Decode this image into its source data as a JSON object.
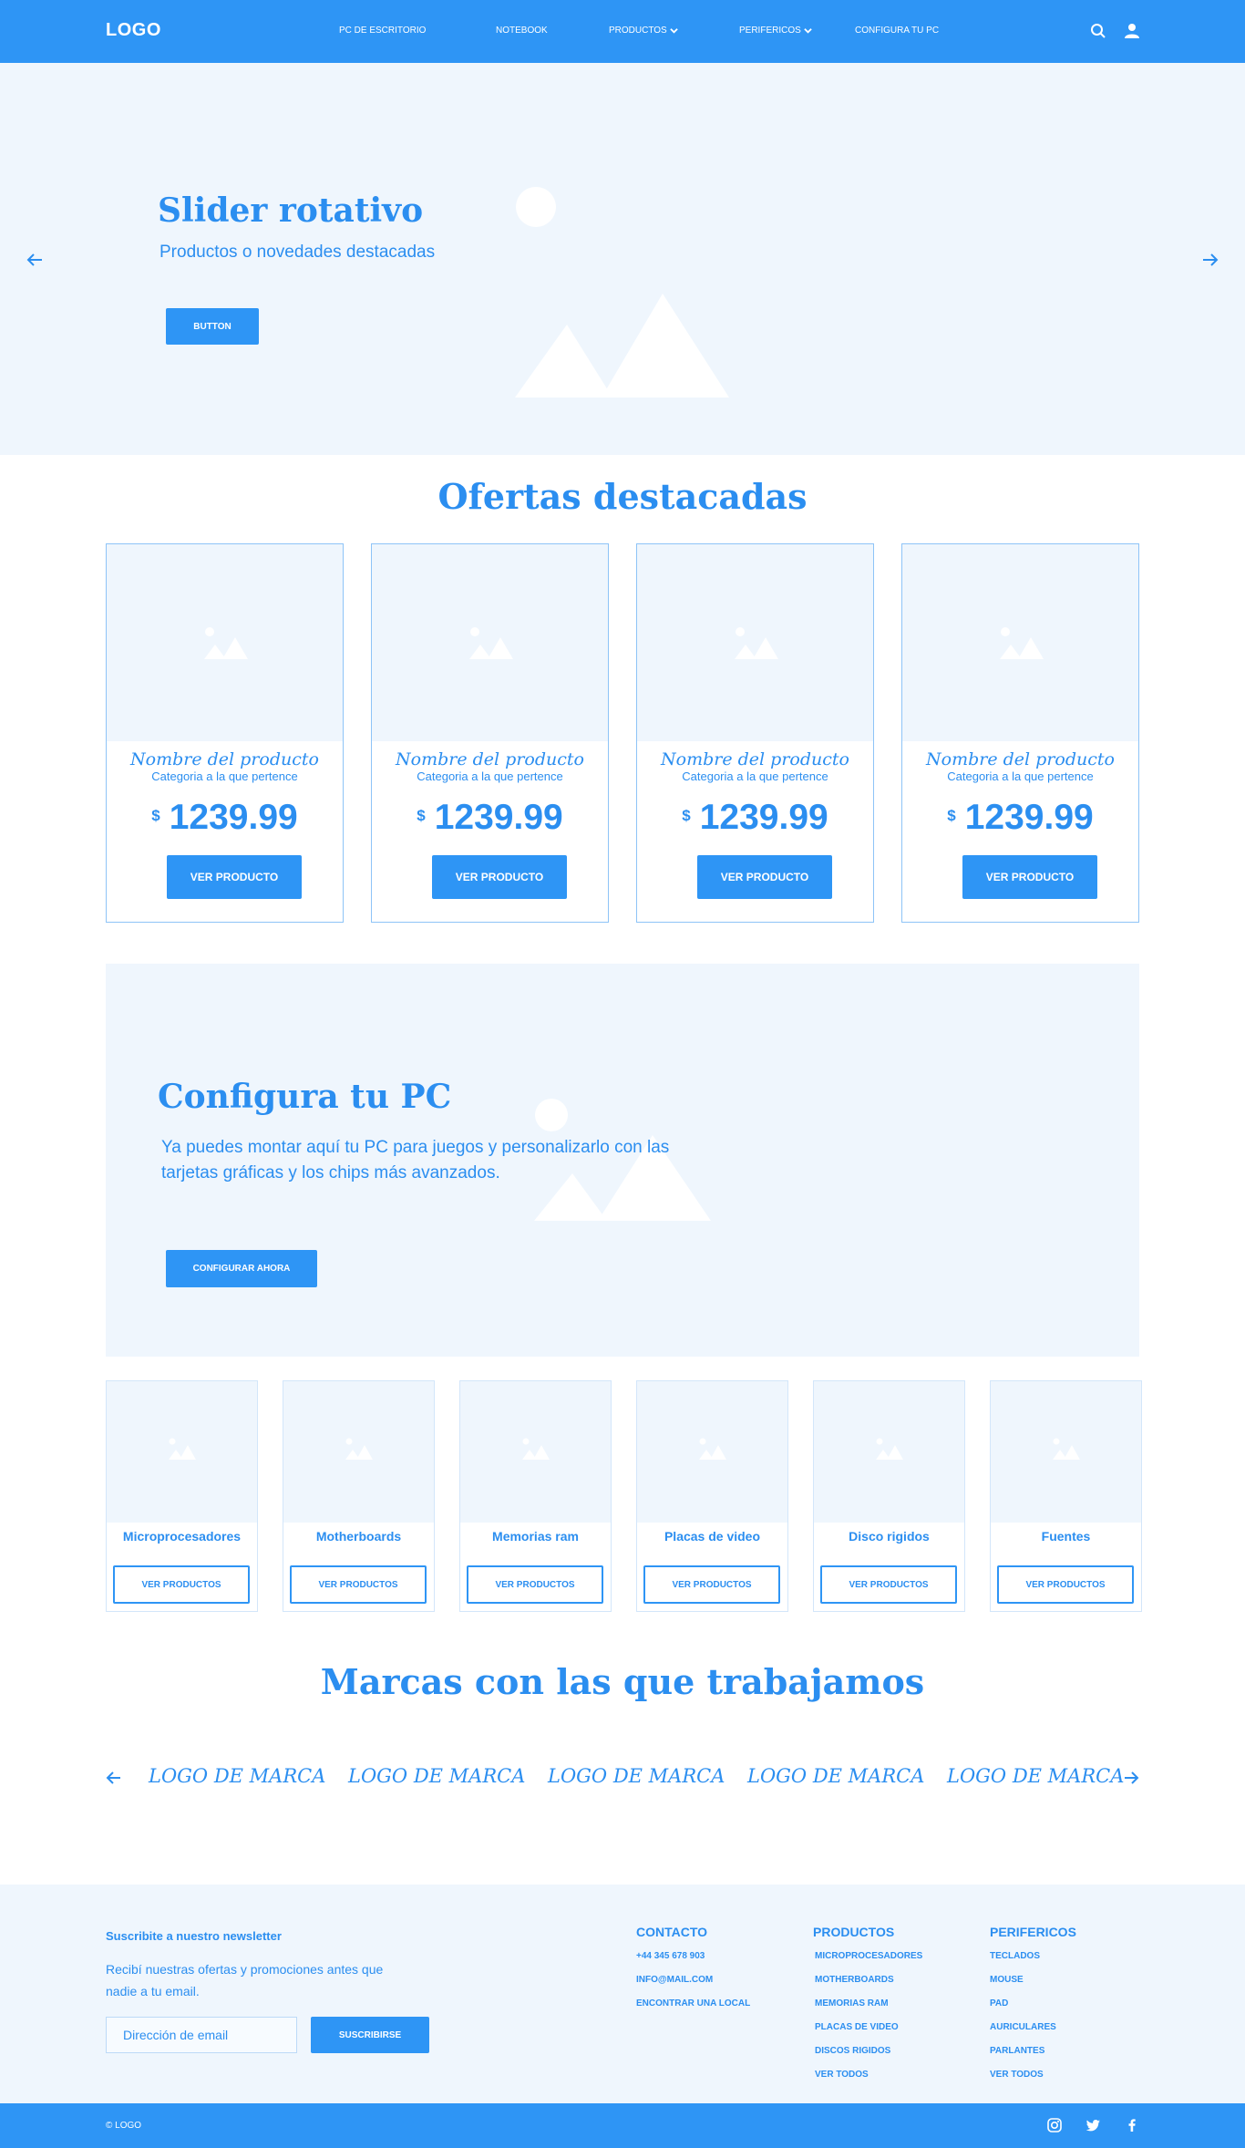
{
  "nav": {
    "logo": "LOGO",
    "items": [
      {
        "label": "PC DE ESCRITORIO"
      },
      {
        "label": "NOTEBOOK"
      },
      {
        "label": "PRODUCTOS"
      },
      {
        "label": "PERIFERICOS"
      },
      {
        "label": "CONFIGURA TU PC"
      }
    ],
    "icons": [
      "search-icon",
      "user-icon"
    ]
  },
  "hero": {
    "title": "Slider rotativo",
    "subtitle": "Productos o novedades destacadas",
    "button": "BUTTON",
    "icons": [
      "arrow-left-icon",
      "arrow-right-icon",
      "image-placeholder-icon"
    ]
  },
  "offers": {
    "title": "Ofertas destacadas",
    "products": [
      {
        "name": "Nombre del producto",
        "category": "Categoria a la que pertence",
        "currency": "$",
        "price": "1239.99",
        "button": "VER PRODUCTO"
      },
      {
        "name": "Nombre del producto",
        "category": "Categoria a la que pertence",
        "currency": "$",
        "price": "1239.99",
        "button": "VER PRODUCTO"
      },
      {
        "name": "Nombre del producto",
        "category": "Categoria a la que pertence",
        "currency": "$",
        "price": "1239.99",
        "button": "VER PRODUCTO"
      },
      {
        "name": "Nombre del producto",
        "category": "Categoria a la que pertence",
        "currency": "$",
        "price": "1239.99",
        "button": "VER PRODUCTO"
      }
    ]
  },
  "configure": {
    "title": "Configura tu PC",
    "text": "Ya puedes montar aquí tu PC para juegos y personalizarlo con las tarjetas gráficas y los chips más avanzados.",
    "button": "CONFIGURAR AHORA"
  },
  "categories": [
    {
      "label": "Microprocesadores",
      "button": "VER PRODUCTOS"
    },
    {
      "label": "Motherboards",
      "button": "VER PRODUCTOS"
    },
    {
      "label": "Memorias ram",
      "button": "VER PRODUCTOS"
    },
    {
      "label": "Placas de video",
      "button": "VER PRODUCTOS"
    },
    {
      "label": "Disco rigidos",
      "button": "VER PRODUCTOS"
    },
    {
      "label": "Fuentes",
      "button": "VER PRODUCTOS"
    }
  ],
  "brands": {
    "title": "Marcas con las que trabajamos",
    "items": [
      "LOGO DE MARCA",
      "LOGO DE MARCA",
      "LOGO DE MARCA",
      "LOGO DE MARCA",
      "LOGO DE MARCA"
    ]
  },
  "footer": {
    "newsletter": {
      "title": "Suscribite a nuestro newsletter",
      "text": "Recibí nuestras ofertas y promociones antes que nadie a tu email.",
      "placeholder": "Dirección de email",
      "button": "SUSCRIBIRSE"
    },
    "contact": {
      "title": "CONTACTO",
      "links": [
        "+44 345 678 903",
        "INFO@MAIL.COM",
        "ENCONTRAR UNA LOCAL"
      ]
    },
    "products": {
      "title": "PRODUCTOS",
      "links": [
        "MICROPROCESADORES",
        "MOTHERBOARDS",
        "MEMORIAS RAM",
        "PLACAS DE VIDEO",
        "DISCOS RIGIDOS",
        "VER TODOS"
      ]
    },
    "peripherals": {
      "title": "PERIFERICOS",
      "links": [
        "TECLADOS",
        "MOUSE",
        "PAD",
        "AURICULARES",
        "PARLANTES",
        "VER TODOS"
      ]
    },
    "copyright": "© LOGO",
    "social": [
      "instagram-icon",
      "twitter-icon",
      "facebook-icon"
    ]
  },
  "colors": {
    "primary": "#2e95f5",
    "text": "#2b8ef0",
    "light_bg": "#eff6fd",
    "card_border": "#8ec4f7"
  }
}
